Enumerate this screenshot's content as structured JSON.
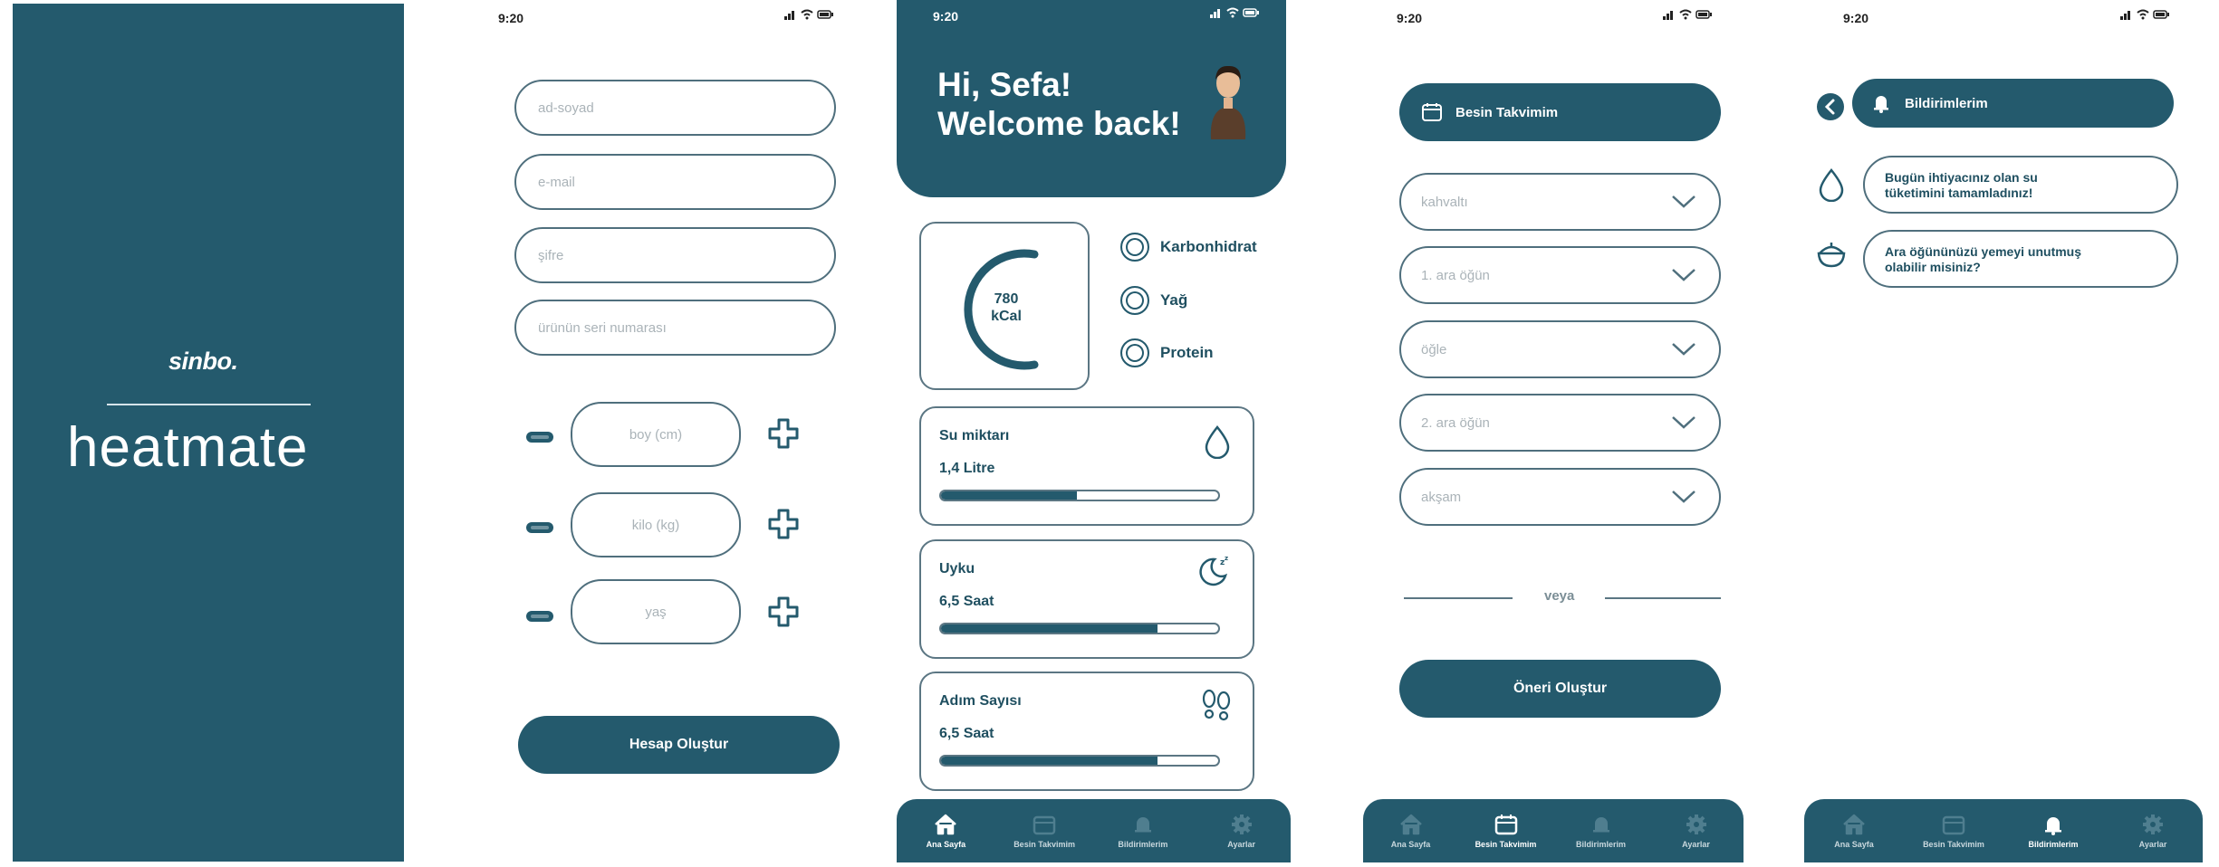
{
  "status": {
    "time": "9:20"
  },
  "splash": {
    "brand_small": "sinbo.",
    "brand_big": "heatmate"
  },
  "register": {
    "fields": {
      "name": "ad-soyad",
      "email": "e-mail",
      "password": "şifre",
      "serial": "ürünün seri numarası",
      "height": "boy (cm)",
      "weight": "kilo (kg)",
      "age": "yaş"
    },
    "create_button": "Hesap Oluştur"
  },
  "home": {
    "greeting_line1": "Hi, Sefa!",
    "greeting_line2": "Welcome back!",
    "calories": {
      "value": "780",
      "unit": "kCal"
    },
    "macros": [
      "Karbonhidrat",
      "Yağ",
      "Protein"
    ],
    "cards": [
      {
        "title": "Su miktarı",
        "value": "1,4 Litre",
        "progress": 0.49,
        "icon": "water-drop-icon"
      },
      {
        "title": "Uyku",
        "value": "6,5 Saat",
        "progress": 0.78,
        "icon": "moon-sleep-icon"
      },
      {
        "title": "Adım Sayısı",
        "value": "6,5 Saat",
        "progress": 0.78,
        "icon": "footsteps-icon"
      }
    ]
  },
  "tabs": [
    "Ana Sayfa",
    "Besin Takvimim",
    "Bildirimlerim",
    "Ayarlar"
  ],
  "calendar": {
    "header": "Besin Takvimim",
    "meals": [
      "kahvaltı",
      "1. ara öğün",
      "öğle",
      "2. ara öğün",
      "akşam"
    ],
    "or_label": "veya",
    "suggest_button": "Öneri Oluştur"
  },
  "notifications": {
    "header": "Bildirimlerim",
    "items": [
      {
        "icon": "water-drop-icon",
        "line1": "Bugün ihtiyacınız olan su",
        "line2": "tüketimini tamamladınız!"
      },
      {
        "icon": "food-bowl-icon",
        "line1": "Ara öğününüzü yemeyi unutmuş",
        "line2": "olabilir misiniz?"
      }
    ]
  },
  "colors": {
    "primary": "#245a6d",
    "border": "#4f6f7d",
    "placeholder": "#aab3b8"
  }
}
